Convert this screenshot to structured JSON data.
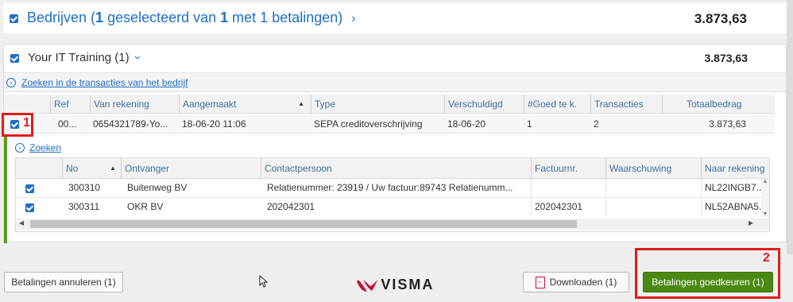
{
  "company_header": {
    "text_prefix": "Bedrijven (",
    "selected": "1",
    "mid": " geselecteerd van ",
    "total": "1",
    "suffix": " met 1 betalingen)",
    "amount": "3.873,63"
  },
  "company": {
    "name": "Your IT Training (1)",
    "amount": "3.873,63",
    "search_link": "Zoeken in de transacties van het bedrijf"
  },
  "transactions": {
    "columns": [
      "Ref",
      "Van rekening",
      "Aangemaakt",
      "Type",
      "Verschuldigd",
      "#Goed te k.",
      "Transacties",
      "Totaalbedrag"
    ],
    "row": {
      "ref": "00...",
      "van_rekening": "0654321789-Yo...",
      "aangemaakt": "18-06-20 11:06",
      "type": "SEPA creditoverschrijving",
      "verschuldigd": "18-06-20",
      "goed": "1",
      "transacties": "2",
      "totaal": "3.873,63"
    }
  },
  "payments": {
    "search_link": "Zoeken",
    "columns": [
      "No",
      "Ontvanger",
      "Contactpersoon",
      "Factuurnr.",
      "Waarschuwing",
      "Naar rekening"
    ],
    "rows": [
      {
        "no": "300310",
        "ontvanger": "Buitenweg BV",
        "contact": "Relatienummer: 23919 / Uw factuur:89743 Relatienumm...",
        "factuur": "",
        "waarschuwing": "",
        "rekening": "NL22INGB7..."
      },
      {
        "no": "300311",
        "ontvanger": "OKR BV",
        "contact": "202042301",
        "factuur": "202042301",
        "waarschuwing": "",
        "rekening": "NL52ABNA5..."
      }
    ]
  },
  "annotations": {
    "one": "1",
    "two": "2"
  },
  "footer": {
    "cancel": "Betalingen annuleren (1)",
    "download": "Downloaden (1)",
    "approve": "Betalingen goedkeuren (1)",
    "logo": "VISMA"
  },
  "colors": {
    "accent": "#1f6fc5",
    "approve": "#4b8a12",
    "annotation": "#e21b1b",
    "logo": "#c4123a"
  }
}
